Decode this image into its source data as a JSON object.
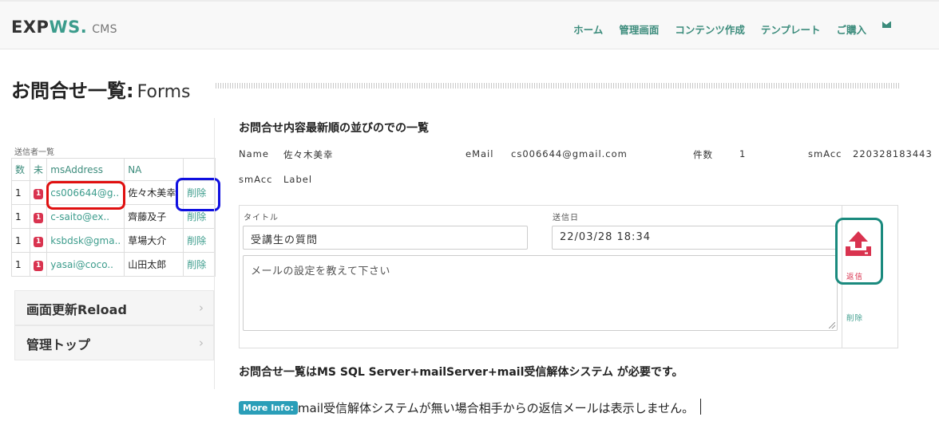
{
  "brand": {
    "exp": "EXP",
    "ws": "WS.",
    "cms": "CMS"
  },
  "nav": {
    "items": [
      "ホーム",
      "管理画面",
      "コンテンツ作成",
      "テンプレート",
      "ご購入"
    ]
  },
  "page": {
    "title": "お問合せ一覧:",
    "subtitle": "Forms"
  },
  "sidebar": {
    "caption": "送信者一覧",
    "columns": [
      "数",
      "未",
      "msAddress",
      "NA",
      ""
    ],
    "rows": [
      {
        "num": "1",
        "unread": "1",
        "address": "cs006644@g..",
        "name": "佐々木美幸",
        "action": "削除"
      },
      {
        "num": "1",
        "unread": "1",
        "address": "c-saito@ex..",
        "name": "齊藤及子",
        "action": "削除"
      },
      {
        "num": "1",
        "unread": "1",
        "address": "ksbdsk@gma..",
        "name": "草場大介",
        "action": "削除"
      },
      {
        "num": "1",
        "unread": "1",
        "address": "yasai@coco..",
        "name": "山田太郎",
        "action": "削除"
      }
    ],
    "reload_label": "画面更新Reload",
    "admin_label": "管理トップ"
  },
  "main": {
    "heading": "お問合せ内容最新順の並びのでの一覧",
    "name_label": "Name",
    "name_value": "佐々木美幸",
    "email_label": "eMail",
    "email_value": "cs006644@gmail.com",
    "count_label": "件数",
    "count_value": "1",
    "smacc_label": "smAcc",
    "smacc_value": "220328183443",
    "smacc_label2": "smAcc",
    "label_label": "Label"
  },
  "form": {
    "title_label": "タイトル",
    "title_value": "受講生の質問",
    "date_label": "送信日",
    "date_value": "22/03/28 18:34",
    "body_value": "メールの設定を教えて下さい",
    "reply_label": "返信",
    "delete_label": "削除"
  },
  "notes": {
    "requirement": "お問合せ一覧はMS SQL Server+mailServer+mail受信解体システム が必要です。",
    "more_info_badge": "More Info:",
    "more_info_text": "mail受信解体システムが無い場合相手からの返信メールは表示しません。"
  },
  "colors": {
    "accent": "#3c8c7c",
    "badge_red": "#d9334f",
    "info_blue": "#2a9eb8"
  }
}
